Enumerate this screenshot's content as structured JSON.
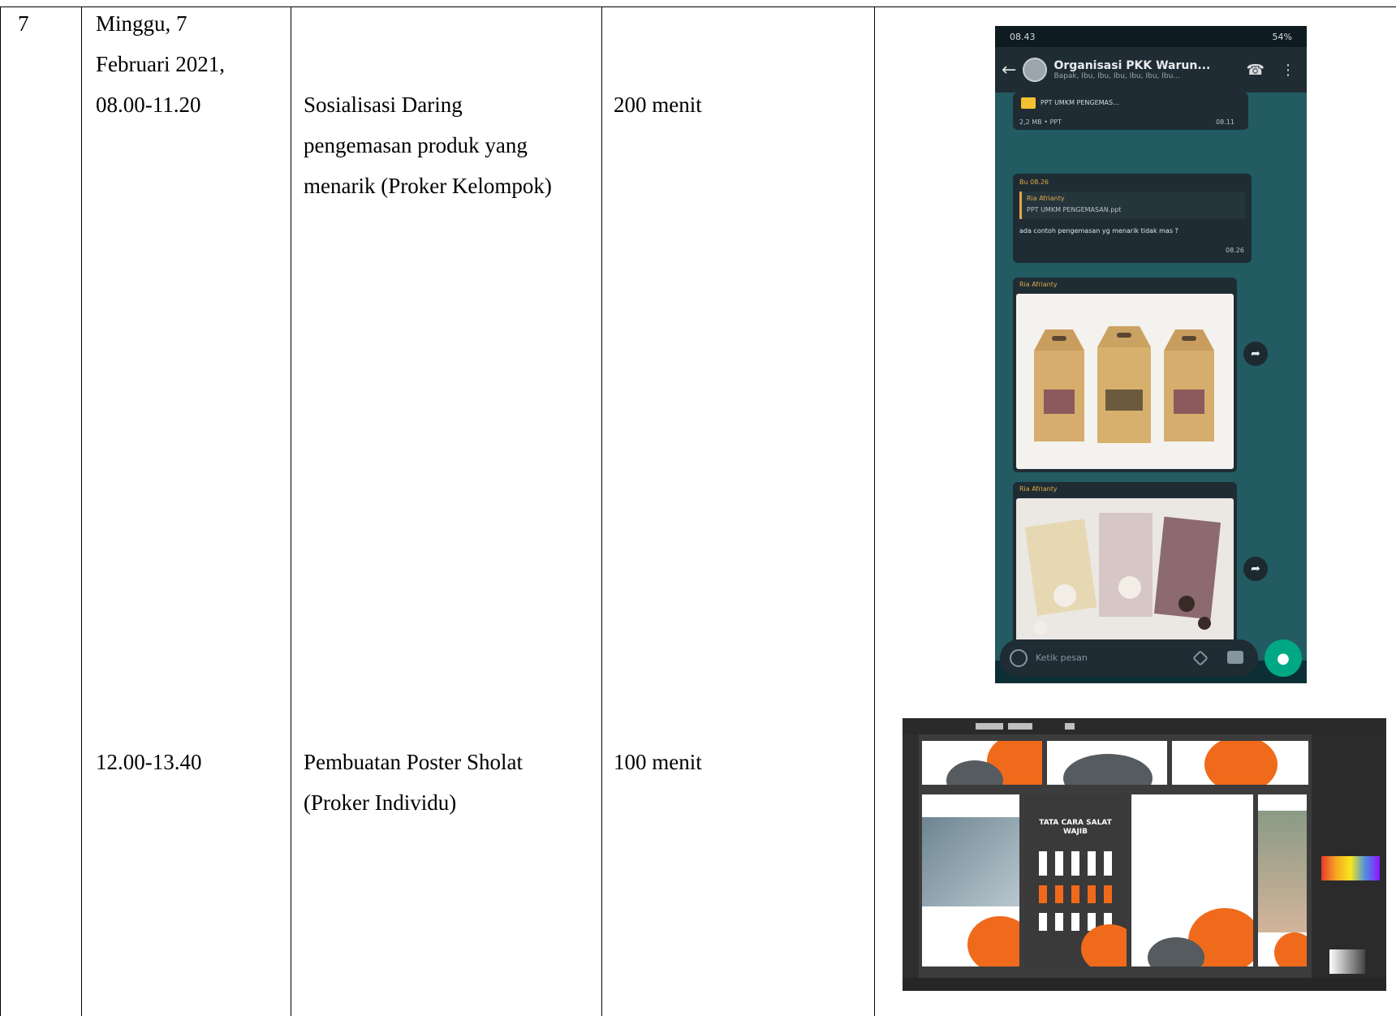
{
  "table": {
    "row_number": "7",
    "date": {
      "line1": "Minggu, 7",
      "line2": "Februari 2021,",
      "line3": "08.00-11.20"
    },
    "activities": [
      {
        "time": "08.00-11.20",
        "title_line1": "Sosialisasi Daring",
        "title_line2": "pengemasan produk yang",
        "title_line3": "menarik (Proker Kelompok)",
        "duration": "200 menit"
      },
      {
        "time": "12.00-13.40",
        "title_line1": "Pembuatan Poster Sholat",
        "title_line2": "(Proker Individu)",
        "duration": "100 menit"
      }
    ]
  },
  "whatsapp": {
    "status_time": "08.43",
    "status_icons": "54%",
    "chat_title": "Organisasi PKK Warun...",
    "chat_subtitle": "Bapak, Ibu, Ibu, Ibu, Ibu, Ibu, Ibu...",
    "doc_name": "PPT UMKM PENGEMAS...",
    "doc_meta": "2,2 MB • PPT",
    "doc_time": "08.11",
    "msg_sender": "Bu 08.26",
    "quote_sender": "Ria Afrianty",
    "quote_text": "PPT UMKM PENGEMASAN.ppt",
    "msg_text": "ada contoh pengemasan yg menarik tidak mas ?",
    "msg_time": "08.26",
    "img1_sender": "Ria Afrianty",
    "img2_sender": "Ria Afrianty",
    "input_placeholder": "Ketik pesan",
    "colors": {
      "header": "#1f2c33",
      "chat_bg": "#225b62",
      "accent": "#00a884"
    }
  },
  "illustrator": {
    "poster_heading": "TATA CARA SALAT WAJIB",
    "colors": {
      "orange": "#f06a1c",
      "workspace": "#3c3c3c"
    }
  }
}
